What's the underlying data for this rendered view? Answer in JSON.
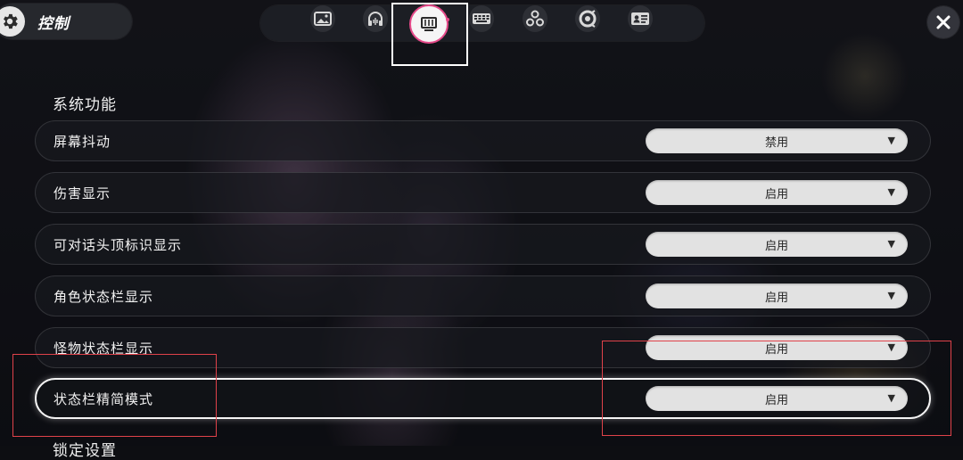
{
  "header": {
    "title": "控制",
    "settings_icon": "gear-icon",
    "close_icon": "close-icon"
  },
  "tabs": [
    {
      "icon": "image-icon"
    },
    {
      "icon": "headphones-icon"
    },
    {
      "icon": "display-icon",
      "active": true
    },
    {
      "icon": "keyboard-icon"
    },
    {
      "icon": "circles-icon"
    },
    {
      "icon": "gamepad-icon"
    },
    {
      "icon": "profile-card-icon"
    }
  ],
  "section": {
    "title": "系统功能",
    "next_title": "锁定设置"
  },
  "settings": [
    {
      "label": "屏幕抖动",
      "value": "禁用"
    },
    {
      "label": "伤害显示",
      "value": "启用"
    },
    {
      "label": "可对话头顶标识显示",
      "value": "启用"
    },
    {
      "label": "角色状态栏显示",
      "value": "启用"
    },
    {
      "label": "怪物状态栏显示",
      "value": "启用"
    },
    {
      "label": "状态栏精简模式",
      "value": "启用"
    }
  ],
  "colors": {
    "accent": "#e64a8a",
    "annotation_red": "#e0424a",
    "dropdown_bg": "#e2e2e2"
  }
}
